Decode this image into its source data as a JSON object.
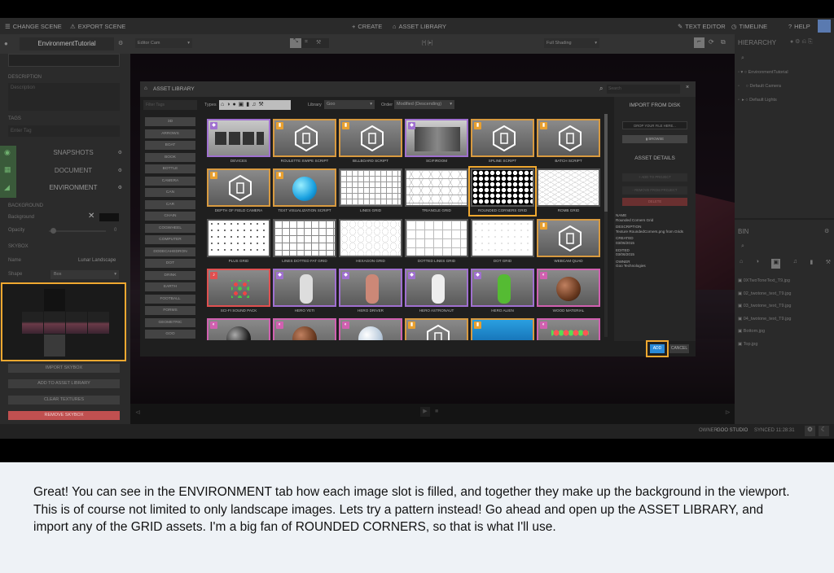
{
  "toolbar": {
    "change_scene": "CHANGE SCENE",
    "export_scene": "EXPORT SCENE",
    "create": "CREATE",
    "asset_library": "ASSET LIBRARY",
    "text_editor": "TEXT EDITOR",
    "timeline": "TIMELINE",
    "help": "HELP"
  },
  "subbar": {
    "project_name": "EnvironmentTutorial",
    "camera": "Editor Cam",
    "shading": "Full Shading"
  },
  "left_panel": {
    "description_label": "DESCRIPTION",
    "description_placeholder": "Description",
    "tags_label": "TAGS",
    "tags_placeholder": "Enter Tag",
    "snapshots": "SNAPSHOTS",
    "document": "DOCUMENT",
    "environment": "ENVIRONMENT",
    "background_heading": "BACKGROUND",
    "background_label": "Background",
    "opacity_label": "Opacity",
    "opacity_value": "0",
    "skybox_heading": "SKYBOX",
    "name_label": "Name",
    "name_value": "Lunar Landscape",
    "shape_label": "Shape",
    "shape_value": "Box",
    "import_skybox": "IMPORT SKYBOX",
    "add_to_asset_library": "ADD TO ASSET LIBRARY",
    "clear_textures": "CLEAR TEXTURES",
    "remove_skybox": "REMOVE SKYBOX"
  },
  "hierarchy": {
    "title": "HIERARCHY",
    "items": [
      "EnvironmentTutorial",
      "Default Camera",
      "Default Lights"
    ]
  },
  "bin": {
    "title": "BIN",
    "files": [
      "0XTwoToneText_T9.jpg",
      "02_twotone_text_T9.jpg",
      "03_twotone_text_T9.jpg",
      "04_twotone_text_T9.jpg",
      "Bottom.jpg",
      "Top.jpg"
    ]
  },
  "status": {
    "owner_label": "OWNER",
    "owner": "GOO STUDIO",
    "synced": "SYNCED 11:28:31"
  },
  "modal": {
    "title": "ASSET LIBRARY",
    "search_placeholder": "Search",
    "filter_placeholder": "Filter Tags",
    "types_label": "Types",
    "library_label": "Library",
    "library_value": "Goo",
    "order_label": "Order",
    "order_value": "Modified (Descending)",
    "categories": [
      "3D",
      "ARROWS",
      "BOAT",
      "BOOK",
      "BOTTLE",
      "CAMERA",
      "CAN",
      "CAR",
      "CHAIN",
      "COGWHEEL",
      "COMPUTER",
      "DODECAHEDRON",
      "DOT",
      "DRINK",
      "EARTH",
      "FOOTBALL",
      "FORMS",
      "GEOMETRIC",
      "GOO"
    ],
    "assets": [
      {
        "name": "DEVICES",
        "kind": "devices",
        "badge": "box"
      },
      {
        "name": "ROULETTE SWIPE SCRIPT",
        "kind": "script",
        "badge": "script"
      },
      {
        "name": "BILLBOARD SCRIPT",
        "kind": "script",
        "badge": "script"
      },
      {
        "name": "SCIFIROOM",
        "kind": "room",
        "badge": "box"
      },
      {
        "name": "SPLINE SCRIPT",
        "kind": "script",
        "badge": "script"
      },
      {
        "name": "BATCH SCRIPT",
        "kind": "script",
        "badge": "script"
      },
      {
        "name": "DEPTH OF FIELD CAMERA",
        "kind": "script",
        "badge": "script"
      },
      {
        "name": "TEXT VISUALIZATION SCRIPT",
        "kind": "ball",
        "badge": "script"
      },
      {
        "name": "LINES GRID",
        "kind": "lines",
        "badge": ""
      },
      {
        "name": "TRIANGLE GRID",
        "kind": "triangle",
        "badge": ""
      },
      {
        "name": "ROUNDED CORNERS GRID",
        "kind": "rounded",
        "badge": ""
      },
      {
        "name": "ROMB GRID",
        "kind": "romb",
        "badge": ""
      },
      {
        "name": "PLUS GRID",
        "kind": "plus",
        "badge": ""
      },
      {
        "name": "LINES DOTTED FAT GRID",
        "kind": "dottedfat",
        "badge": ""
      },
      {
        "name": "HEXAGON GRID",
        "kind": "hexagon",
        "badge": ""
      },
      {
        "name": "DOTTED LINES GRID",
        "kind": "dotted",
        "badge": ""
      },
      {
        "name": "DOT GRID",
        "kind": "dot",
        "badge": ""
      },
      {
        "name": "WEBCAM QUAD",
        "kind": "script",
        "badge": "script"
      },
      {
        "name": "SCI-FI SOUND PACK",
        "kind": "sound",
        "badge": "sound"
      },
      {
        "name": "HERO YETI",
        "kind": "hero-yeti",
        "badge": "box"
      },
      {
        "name": "HERO DRIVER",
        "kind": "hero-driver",
        "badge": "box"
      },
      {
        "name": "HERO ASTRONAUT",
        "kind": "hero-astro",
        "badge": "box"
      },
      {
        "name": "HERO ALIEN",
        "kind": "hero-alien",
        "badge": "box"
      },
      {
        "name": "WOOD MATERIAL",
        "kind": "wood",
        "badge": "mat"
      },
      {
        "name": "",
        "kind": "blackball",
        "badge": "mat"
      },
      {
        "name": "",
        "kind": "rustball",
        "badge": "mat"
      },
      {
        "name": "",
        "kind": "glassball",
        "badge": "mat"
      },
      {
        "name": "",
        "kind": "script",
        "badge": "script"
      },
      {
        "name": "",
        "kind": "water",
        "badge": "script"
      },
      {
        "name": "",
        "kind": "balls",
        "badge": "mat"
      }
    ],
    "import_from_disk": "IMPORT FROM DISK",
    "drop_file": "DROP YOUR FILE HERE...",
    "browse": "BROWSE",
    "asset_details": "ASSET DETAILS",
    "add_to_project": "+ ADD TO PROJECT",
    "remove_from_project": "- REMOVE FROM PROJECT",
    "delete": "DELETE",
    "details": {
      "name_label": "NAME",
      "name": "Rounded Corners Grid",
      "description_label": "DESCRIPTION",
      "description": "Texture RoundedCorners.png from Grids",
      "created_label": "CREATED",
      "created": "03/06/2015",
      "edited_label": "EDITED",
      "edited": "03/06/2015",
      "owner_label": "OWNER",
      "owner": "Goo Technologies"
    },
    "add": "ADD",
    "cancel": "CANCEL"
  },
  "caption": "Great! You can see in the ENVIRONMENT tab how each image slot is filled, and together they make up the background in the viewport. This is of course not limited to only landscape images. Lets try a pattern instead! Go ahead and open up the ASSET LIBRARY, and import any of the GRID assets. I'm a big fan of ROUNDED CORNERS, so that is what I'll use.",
  "colors": {
    "highlight": "#f0a830",
    "script_badge": "#e8a030",
    "box_badge": "#a070d0",
    "sound_badge": "#e05050",
    "material_badge": "#d060b0",
    "add_button": "#2a8ad8",
    "delete_button": "#b04040",
    "remove_skybox": "#c05050"
  }
}
